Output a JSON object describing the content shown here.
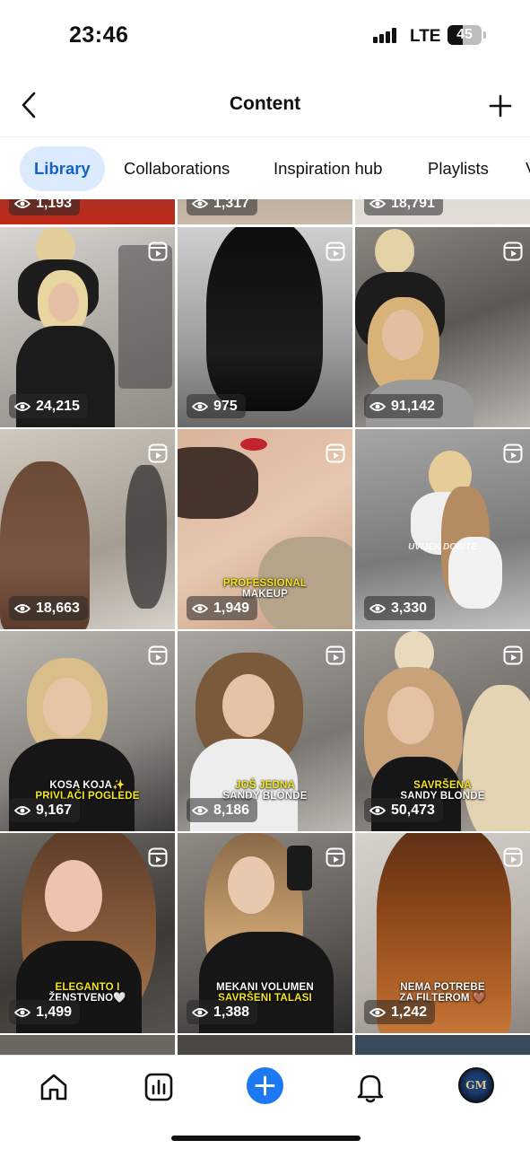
{
  "status_bar": {
    "time": "23:46",
    "network": "LTE",
    "battery_percent": "45",
    "battery_level": 0.45
  },
  "header": {
    "title": "Content",
    "back_icon": "chevron-left-icon",
    "add_icon": "plus-icon"
  },
  "tabs": [
    {
      "label": "Library",
      "active": true
    },
    {
      "label": "Collaborations",
      "active": false
    },
    {
      "label": "Inspiration hub",
      "active": false
    },
    {
      "label": "Playlists",
      "active": false
    },
    {
      "label": "V",
      "active": false
    }
  ],
  "grid": {
    "partial_top_views": [
      "1,193",
      "1,317",
      "18,791"
    ],
    "tiles": [
      {
        "views": "24,215"
      },
      {
        "views": "975"
      },
      {
        "views": "91,142"
      },
      {
        "views": "18,663"
      },
      {
        "views": "1,949",
        "caption_lines": [
          "PROFESSIONAL",
          "MAKEUP"
        ]
      },
      {
        "views": "3,330",
        "overlay": "UVIJEK DOĐITE"
      },
      {
        "views": "9,167",
        "caption_lines": [
          "KOSA KOJA✨",
          "PRIVLAČI POGLEDE"
        ]
      },
      {
        "views": "8,186",
        "caption_lines": [
          "JOŠ JEDNA",
          "SANDY BLONDE"
        ]
      },
      {
        "views": "50,473",
        "caption_lines": [
          "SAVRŠENA",
          "SANDY BLONDE"
        ]
      },
      {
        "views": "1,499",
        "caption_lines": [
          "ELEGANTO I",
          "ŽENSTVENO🤍"
        ]
      },
      {
        "views": "1,388",
        "caption_lines": [
          "MEKANI VOLUMEN",
          "SAVRŠENI TALASI"
        ]
      },
      {
        "views": "1,242",
        "caption_lines": [
          "NEMA POTREBE",
          "ZA FILTEROM 🤎"
        ]
      }
    ]
  },
  "bottom_nav": {
    "items": [
      "home-icon",
      "insights-icon",
      "create-icon",
      "notifications-icon",
      "profile-avatar"
    ],
    "avatar_initials": "GM"
  },
  "colors": {
    "accent": "#1c79f2",
    "active_tab_bg": "#dbeafc",
    "active_tab_text": "#1662c4",
    "caption_yellow": "#f4e51c"
  }
}
